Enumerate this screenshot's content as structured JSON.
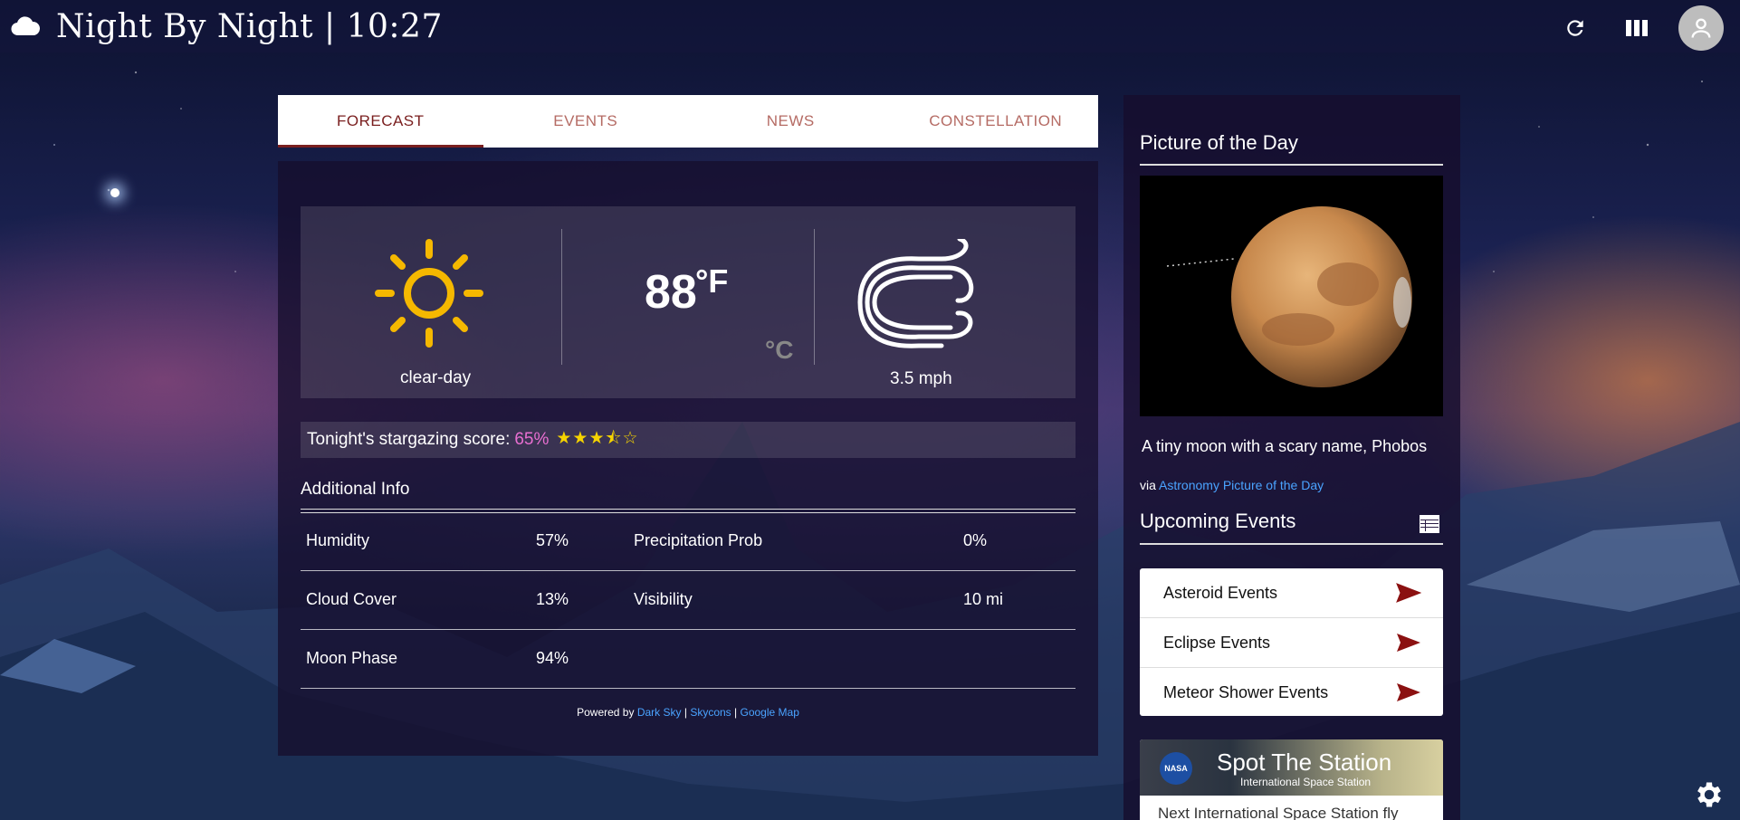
{
  "header": {
    "title": "Night By Night | 10:27"
  },
  "tabs": [
    {
      "label": "FORECAST",
      "active": true
    },
    {
      "label": "EVENTS",
      "active": false
    },
    {
      "label": "NEWS",
      "active": false
    },
    {
      "label": "CONSTELLATION",
      "active": false
    }
  ],
  "forecast": {
    "condition_icon": "sun-icon",
    "condition": "clear-day",
    "temperature": "88",
    "temperature_unit": "°F",
    "alt_unit": "°C",
    "wind_icon": "wind-icon",
    "wind_speed": "3.5 mph",
    "stargazing_label": "Tonight's stargazing score:",
    "stargazing_score": "65%",
    "stargazing_stars": 3.5,
    "stargazing_stars_text": "★★★⯪☆",
    "additional_info_title": "Additional Info",
    "info": {
      "humidity_label": "Humidity",
      "humidity_value": "57%",
      "precip_label": "Precipitation Prob",
      "precip_value": "0%",
      "cloud_label": "Cloud Cover",
      "cloud_value": "13%",
      "visibility_label": "Visibility",
      "visibility_value": "10 mi",
      "moon_label": "Moon Phase",
      "moon_value": "94%"
    },
    "powered_by": {
      "prefix": "Powered by",
      "link1": "Dark Sky",
      "sep": "|",
      "link2": "Skycons",
      "link3": "Google Map"
    }
  },
  "sidebar": {
    "pod_title": "Picture of the Day",
    "pod_caption": "A tiny moon with a scary name, Phobos",
    "pod_via_prefix": "via",
    "pod_via_link": "Astronomy Picture of the Day",
    "events_title": "Upcoming Events",
    "events": [
      {
        "label": "Asteroid Events"
      },
      {
        "label": "Eclipse Events"
      },
      {
        "label": "Meteor Shower Events"
      }
    ],
    "iss": {
      "title": "Spot The Station",
      "subtitle": "International Space Station",
      "logo_text": "NASA",
      "next_text": "Next International Space Station fly"
    }
  },
  "colors": {
    "accent": "#7a1f1f",
    "tab_inactive": "#b56b64",
    "score": "#e86fd1",
    "stars": "#f5d300",
    "link": "#4aa3ff",
    "sun": "#f5b800"
  }
}
